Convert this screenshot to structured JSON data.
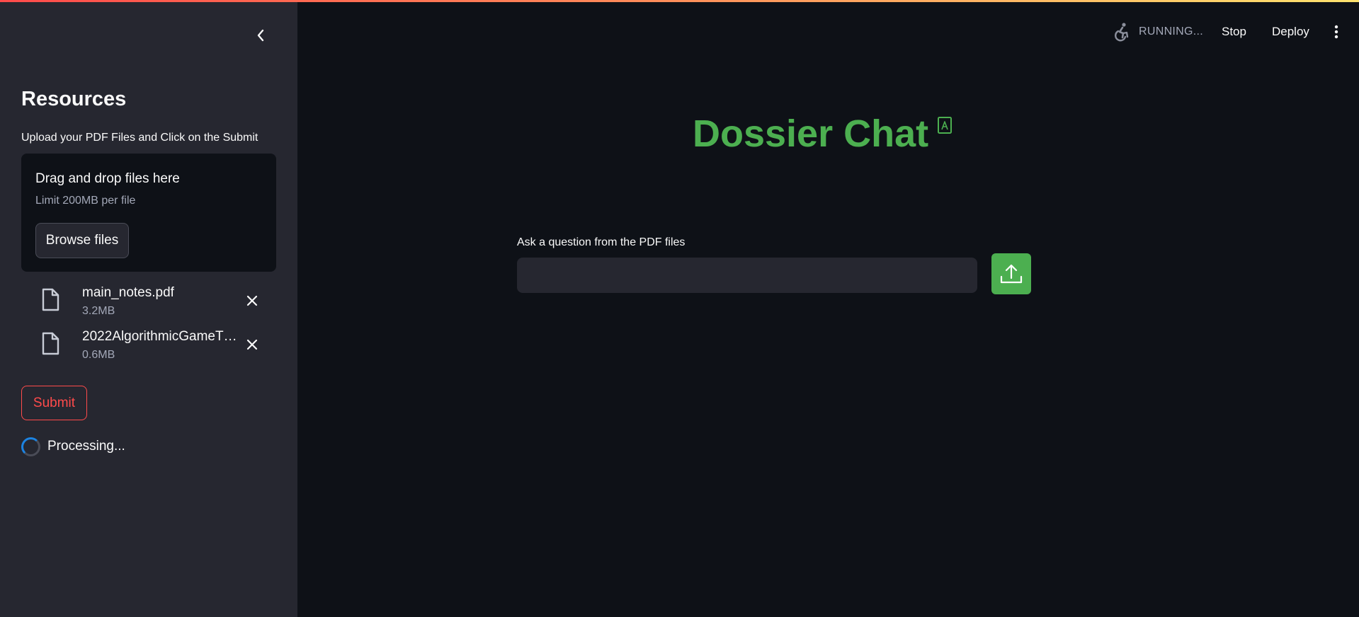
{
  "sidebar": {
    "title": "Resources",
    "caption": "Upload your PDF Files and Click on the Submit",
    "dropzone": {
      "title": "Drag and drop files here",
      "limit": "Limit 200MB per file",
      "browse_label": "Browse files"
    },
    "files": [
      {
        "name": "main_notes.pdf",
        "size": "3.2MB"
      },
      {
        "name": "2022AlgorithmicGameTh…",
        "size": "0.6MB"
      }
    ],
    "submit_label": "Submit",
    "processing_label": "Processing..."
  },
  "header": {
    "status_label": "RUNNING...",
    "stop_label": "Stop",
    "deploy_label": "Deploy"
  },
  "main": {
    "title": "Dossier Chat",
    "question_label": "Ask a question from the PDF files",
    "question_value": ""
  },
  "colors": {
    "accent_green": "#4caf50",
    "submit_red": "#ff4b4b",
    "sidebar_bg": "#262730",
    "main_bg": "#0e1117"
  },
  "icons": {
    "collapse": "chevron-left-icon",
    "file": "file-icon",
    "remove": "close-icon",
    "running": "running-man-icon",
    "menu": "more-vertical-icon",
    "title_anchor": "pdf-file-icon",
    "upload": "upload-icon"
  }
}
